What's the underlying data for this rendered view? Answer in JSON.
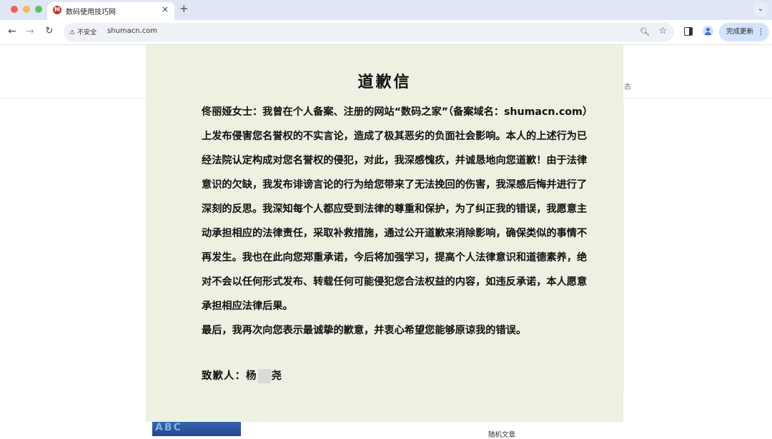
{
  "browser": {
    "tab_title": "数码使用技巧网",
    "favicon_text": "M",
    "tab_close": "×",
    "new_tab": "+",
    "tab_menu": "⌄",
    "security_label": "不安全",
    "url": "shumacn.com",
    "update_button": "完成更新"
  },
  "background": {
    "side_text": "态",
    "random_article": "随机文章",
    "thumb_text": "ABC"
  },
  "letter": {
    "title": "道歉信",
    "paragraph_1": "佟丽娅女士：我曾在个人备案、注册的网站“数码之家”（备案域名：shumacn.com）上发布侵害您名誉权的不实言论，造成了极其恶劣的负面社会影响。本人的上述行为已经法院认定构成对您名誉权的侵犯，对此，我深感愧疚，并诚恳地向您道歉！由于法律意识的欠缺，我发布诽谤言论的行为给您带来了无法挽回的伤害，我深感后悔并进行了深刻的反思。我深知每个人都应受到法律的尊重和保护，为了纠正我的错误，我愿意主动承担相应的法律责任，采取补救措施，通过公开道歉来消除影响，确保类似的事情不再发生。我也在此向您郑重承诺，今后将加强学习，提高个人法律意识和道德素养，绝对不会以任何形式发布、转载任何可能侵犯您合法权益的内容，如违反承诺，本人愿意承担相应法律后果。",
    "paragraph_2": "最后，我再次向您表示最诚挚的歉意，并衷心希望您能够原谅我的错误。",
    "sign_label": "致歉人：杨",
    "sign_suffix": "尧"
  }
}
